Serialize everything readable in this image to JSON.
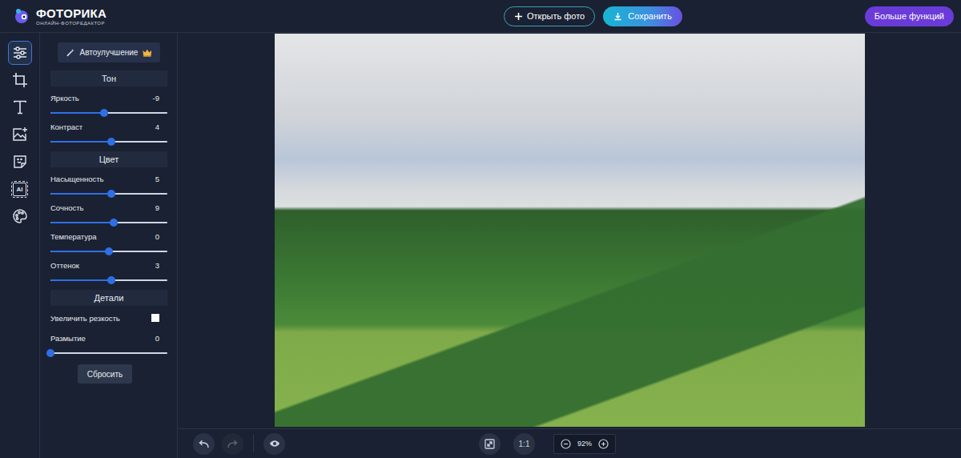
{
  "app": {
    "title": "ФОТОРИКА",
    "subtitle": "ОНЛАЙН-ФОТОРЕДАКТОР"
  },
  "toolbar": {
    "open": "Открыть фото",
    "save": "Сохранить",
    "more": "Больше функций"
  },
  "rail": [
    {
      "kind": "adjust",
      "selected": true
    },
    {
      "kind": "crop",
      "selected": false
    },
    {
      "kind": "text",
      "selected": false
    },
    {
      "kind": "image",
      "selected": false
    },
    {
      "kind": "sticker",
      "selected": false
    },
    {
      "kind": "ai",
      "text": "AI",
      "selected": false
    },
    {
      "kind": "palette",
      "selected": false
    }
  ],
  "panel": {
    "auto": "Автоулучшение",
    "sections": [
      {
        "title": "Тон",
        "controls": [
          {
            "kind": "slider",
            "label": "Яркость",
            "value": "-9",
            "level": 0.46
          },
          {
            "kind": "slider",
            "label": "Контраст",
            "value": "4",
            "level": 0.52
          }
        ]
      },
      {
        "title": "Цвет",
        "controls": [
          {
            "kind": "slider",
            "label": "Насыщенность",
            "value": "5",
            "level": 0.52
          },
          {
            "kind": "slider",
            "label": "Сочность",
            "value": "9",
            "level": 0.54
          },
          {
            "kind": "slider",
            "label": "Температура",
            "value": "0",
            "level": 0.5
          },
          {
            "kind": "slider",
            "label": "Оттенок",
            "value": "3",
            "level": 0.52
          }
        ]
      },
      {
        "title": "Детали",
        "controls": [
          {
            "kind": "checkbox",
            "label": "Увеличить резкость",
            "checked": false
          },
          {
            "kind": "slider",
            "label": "Размытие",
            "value": "0",
            "level": 0
          }
        ]
      }
    ],
    "reset": "Сбросить"
  },
  "bottom": {
    "history": [
      {
        "kind": "undo",
        "disabled": false
      },
      {
        "kind": "redo",
        "disabled": true
      }
    ],
    "actual": "1:1",
    "zoom": "92%"
  }
}
